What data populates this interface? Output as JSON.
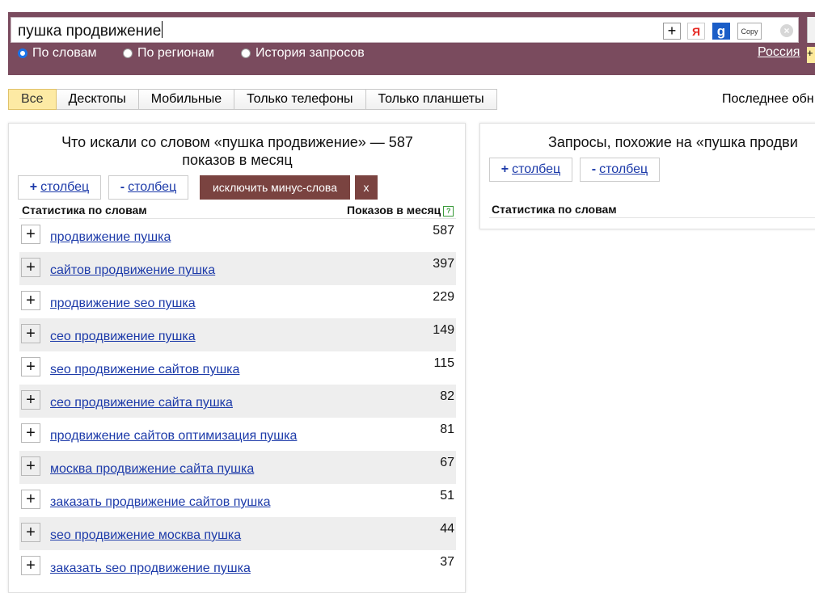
{
  "search": {
    "query": "пушка продвижение",
    "copy_label": "Copy",
    "ya_label": "Я",
    "g_label": "g",
    "plus_label": "+",
    "clear_label": "×"
  },
  "mode": {
    "options": [
      "По словам",
      "По регионам",
      "История запросов"
    ],
    "selected": "По словам",
    "region": "Россия",
    "region_tab": "+"
  },
  "device_tabs": [
    "Все",
    "Десктопы",
    "Мобильные",
    "Только телефоны",
    "Только планшеты"
  ],
  "active_tab": "Все",
  "last_update": "Последнее обн",
  "left": {
    "title_line1": "Что искали со словом «пушка продвижение» — 587",
    "title_line2": "показов в месяц",
    "add_col": "столбец",
    "remove_col": "столбец",
    "add_sign": "+",
    "remove_sign": "-",
    "exclude_label": "исключить минус-слова",
    "x_label": "x",
    "col_stats": "Статистика по словам",
    "col_shows": "Показов в месяц",
    "help": "?",
    "rows": [
      {
        "kw": "продвижение пушка",
        "count": "587"
      },
      {
        "kw": "сайтов продвижение пушка",
        "count": "397"
      },
      {
        "kw": "продвижение seo пушка",
        "count": "229"
      },
      {
        "kw": "сео продвижение пушка",
        "count": "149"
      },
      {
        "kw": "seo продвижение сайтов пушка",
        "count": "115"
      },
      {
        "kw": "сео продвижение сайта пушка",
        "count": "82"
      },
      {
        "kw": "продвижение сайтов оптимизация пушка",
        "count": "81"
      },
      {
        "kw": "москва продвижение сайта пушка",
        "count": "67"
      },
      {
        "kw": "заказать продвижение сайтов пушка",
        "count": "51"
      },
      {
        "kw": "seo продвижение москва пушка",
        "count": "44"
      },
      {
        "kw": "заказать seo продвижение пушка",
        "count": "37"
      }
    ],
    "row_plus": "+"
  },
  "right": {
    "title": "Запросы, похожие на «пушка продви",
    "add_col": "столбец",
    "remove_col": "столбец",
    "add_sign": "+",
    "remove_sign": "-",
    "col_stats": "Статистика по словам"
  }
}
